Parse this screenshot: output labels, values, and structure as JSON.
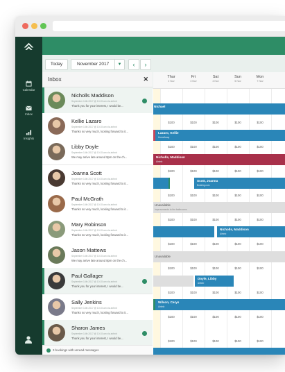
{
  "sidebar": {
    "items": [
      {
        "label": "Calendar",
        "icon": "calendar-icon"
      },
      {
        "label": "Inbox",
        "icon": "envelope-icon"
      },
      {
        "label": "Insights",
        "icon": "bar-chart-icon"
      }
    ]
  },
  "toolbar": {
    "today_label": "Today",
    "month_label": "November 2017"
  },
  "inbox": {
    "title": "Inbox",
    "footer": "3 bookings with unread messages",
    "messages": [
      {
        "name": "Nicholls Maddison",
        "meta": "September 14th 2017 @ 10:15 am via airbnb",
        "preview": "Thank you for your interest, I would be...",
        "unread": true,
        "avatar_color": "#6b8a5a"
      },
      {
        "name": "Kellie Lazaro",
        "meta": "September 14th 2017 @ 10:15 am via airbnb",
        "preview": "Thanks so very much, looking forward to it...",
        "unread": false,
        "avatar_color": "#8a6a58"
      },
      {
        "name": "Libby Doyle",
        "meta": "September 14th 2017 @ 10:15 am via airbnb",
        "preview": "We may arrive late around 8pm on the ch...",
        "unread": false,
        "avatar_color": "#7a6a5a"
      },
      {
        "name": "Joanna Scott",
        "meta": "September 14th 2017 @ 10:15 am via airbnb",
        "preview": "Thanks so very much, looking forward to it...",
        "unread": false,
        "avatar_color": "#4a3a32"
      },
      {
        "name": "Paul McGrath",
        "meta": "September 14th 2017 @ 10:15 am via airbnb",
        "preview": "Thanks so very much, looking forward to it...",
        "unread": false,
        "avatar_color": "#9a6a4a"
      },
      {
        "name": "Mary Robinson",
        "meta": "September 14th 2017 @ 10:15 am via airbnb",
        "preview": "Thanks so very much, looking forward to it...",
        "unread": false,
        "avatar_color": "#8a9a7a"
      },
      {
        "name": "Jason Mattews",
        "meta": "September 14th 2017 @ 10:15 am via airbnb",
        "preview": "We may arrive late around 8pm on the ch...",
        "unread": false,
        "avatar_color": "#6a7a5a"
      },
      {
        "name": "Paul Gallager",
        "meta": "September 14th 2017 @ 10:15 am via airbnb",
        "preview": "Thank you for your interest, I would be...",
        "unread": true,
        "avatar_color": "#3a3a3a"
      },
      {
        "name": "Sally Jenkins",
        "meta": "September 14th 2017 @ 10:15 am via airbnb",
        "preview": "Thanks so very much, looking forward to it...",
        "unread": false,
        "avatar_color": "#7a7a8a"
      },
      {
        "name": "Sharon James",
        "meta": "September 14th 2017 @ 10:15 am via airbnb",
        "preview": "Thank you for your interest, I would be...",
        "unread": true,
        "avatar_color": "#6a5a4a"
      }
    ]
  },
  "calendar": {
    "days": [
      {
        "name": "Thur",
        "date": "2 Nov"
      },
      {
        "name": "Fri",
        "date": "3 Nov"
      },
      {
        "name": "Sat",
        "date": "4 Nov"
      },
      {
        "name": "Sun",
        "date": "5 Nov"
      },
      {
        "name": "Mon",
        "date": "7 Nov"
      }
    ],
    "price": "$100",
    "bookings": [
      {
        "name": "Nichael",
        "source": ""
      },
      {
        "name": "Lazaro, Kellie",
        "source": "HomeAway"
      },
      {
        "name": "Nicholls, Maddison",
        "source": "Airbnb"
      },
      {
        "name": "Scott, Joanna",
        "source": "Booking.com"
      },
      {
        "name": "Nicholls, Maddison",
        "source": "Airbnb"
      },
      {
        "name": "Doyle, Libby",
        "source": "Airbnb"
      },
      {
        "name": "Wilson, Cerys",
        "source": "Airbnb"
      }
    ],
    "unavailable": [
      {
        "label": "Unavailable",
        "sub": "Improvements to the bathrooms"
      },
      {
        "label": "Unavailable",
        "sub": ""
      }
    ]
  },
  "colors": {
    "brand_dark": "#163b2e",
    "brand_green": "#2e8d66",
    "booking_blue": "#2a86b8"
  }
}
